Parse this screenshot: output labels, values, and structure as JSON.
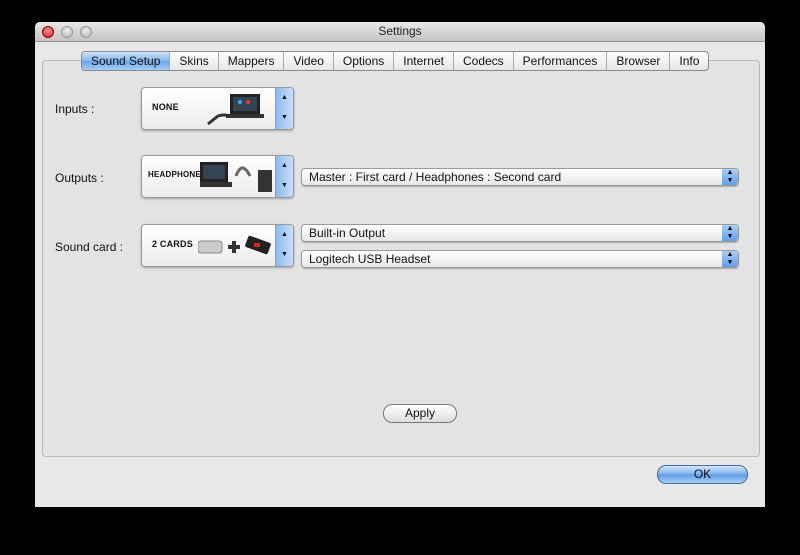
{
  "window": {
    "title": "Settings"
  },
  "tabs": [
    "Sound Setup",
    "Skins",
    "Mappers",
    "Video",
    "Options",
    "Internet",
    "Codecs",
    "Performances",
    "Browser",
    "Info"
  ],
  "active_tab": "Sound Setup",
  "inputs": {
    "label": "Inputs :",
    "selection": "NONE"
  },
  "outputs": {
    "label": "Outputs :",
    "selection": "HEADPHONES",
    "routing": "Master : First card / Headphones : Second card"
  },
  "sound_card": {
    "label": "Sound card :",
    "selection": "2 CARDS",
    "card1": "Built-in Output",
    "card2": "Logitech USB Headset"
  },
  "buttons": {
    "apply": "Apply",
    "ok": "OK"
  }
}
